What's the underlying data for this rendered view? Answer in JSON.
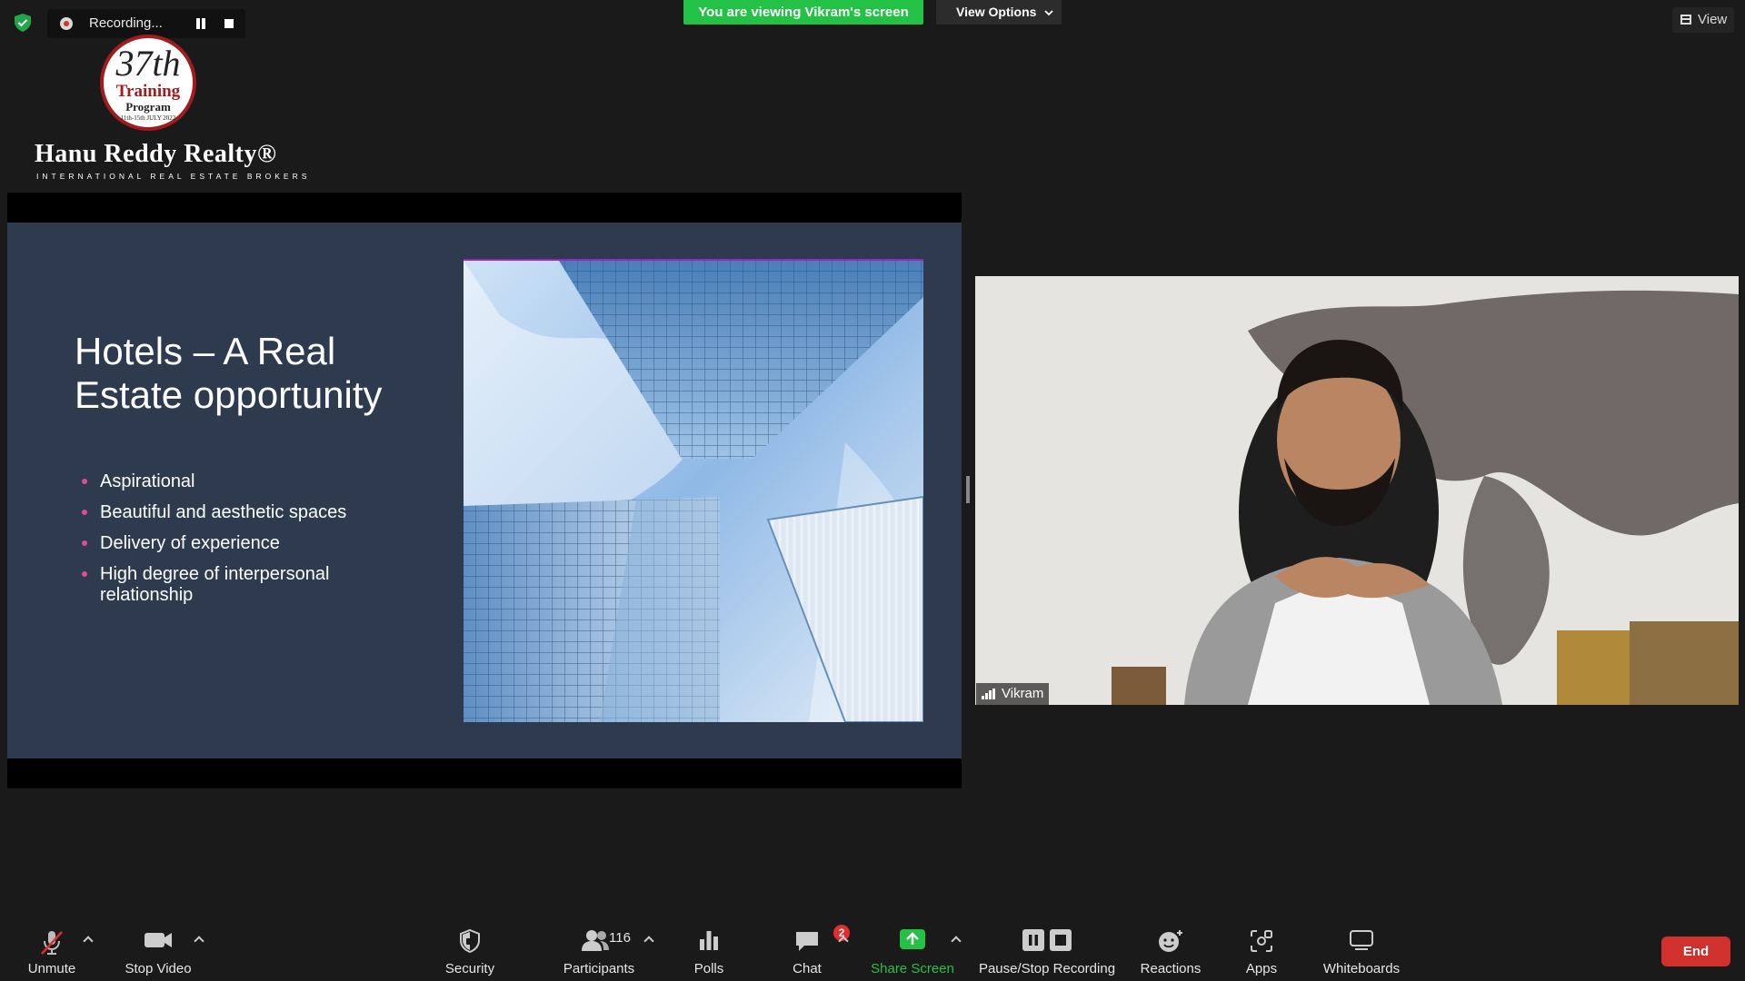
{
  "recording": {
    "label": "Recording..."
  },
  "banner": {
    "viewing": "You are viewing Vikram's screen",
    "view_options": "View Options"
  },
  "view_button": {
    "label": "View"
  },
  "logo": {
    "edition": "37th",
    "line1": "Training",
    "line2": "Program",
    "dates": "11th-15th JULY 2022",
    "brand": "Hanu Reddy Realty®",
    "tagline": "INTERNATIONAL REAL ESTATE BROKERS"
  },
  "slide": {
    "title": "Hotels – A Real Estate opportunity",
    "bullets": [
      "Aspirational",
      " Beautiful and aesthetic spaces",
      "Delivery of experience",
      "High degree of interpersonal relationship"
    ]
  },
  "video": {
    "participant_name": "Vikram"
  },
  "toolbar": {
    "unmute": "Unmute",
    "stop_video": "Stop Video",
    "security": "Security",
    "participants": "Participants",
    "participants_count": "116",
    "polls": "Polls",
    "chat": "Chat",
    "chat_badge": "2",
    "share_screen": "Share Screen",
    "pause_stop_recording": "Pause/Stop Recording",
    "reactions": "Reactions",
    "apps": "Apps",
    "whiteboards": "Whiteboards",
    "end": "End"
  },
  "colors": {
    "banner_green": "#23c247",
    "share_green": "#23c247",
    "end_red": "#d0312d",
    "slide_bg": "#2e3b4e",
    "bullet_pink": "#e24b9a"
  }
}
